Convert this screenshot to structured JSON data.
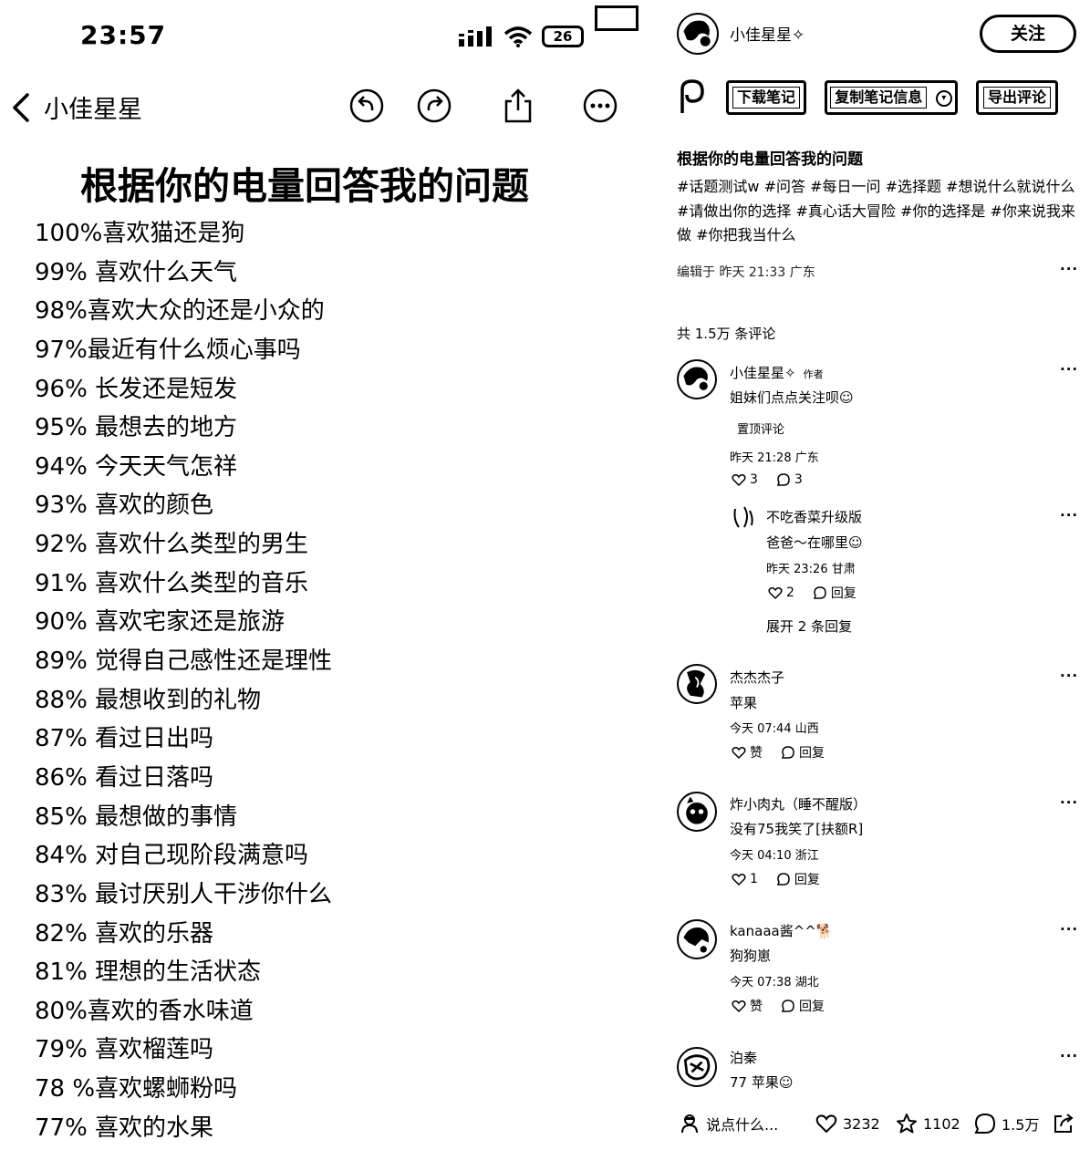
{
  "left": {
    "status": {
      "time": "23:57",
      "battery": "26"
    },
    "nav": {
      "title": "小佳星星"
    },
    "doc_title": "根据你的电量回答我的问题",
    "items": [
      "100%喜欢猫还是狗",
      "99% 喜欢什么天气",
      "98%喜欢大众的还是小众的",
      "97%最近有什么烦心事吗",
      "96% 长发还是短发",
      "95% 最想去的地方",
      "94% 今天天气怎祥",
      "93% 喜欢的颜色",
      "92% 喜欢什么类型的男生",
      "91% 喜欢什么类型的音乐",
      "90% 喜欢宅家还是旅游",
      "89% 觉得自己感性还是理性",
      "88% 最想收到的礼物",
      "87% 看过日出吗",
      "86% 看过日落吗",
      "85% 最想做的事情",
      "84% 对自己现阶段满意吗",
      "83% 最讨厌别人干涉你什么",
      "82% 喜欢的乐器",
      "81% 理想的生活状态",
      "80%喜欢的香水味道",
      "79% 喜欢榴莲吗",
      "78 %喜欢螺蛳粉吗",
      "77% 喜欢的水果"
    ]
  },
  "right": {
    "author": {
      "name": "小佳星星✧",
      "follow_label": "关注"
    },
    "toolbar": {
      "download": "下载笔记",
      "copy_info": "复制笔记信息",
      "export": "导出评论"
    },
    "note": {
      "title": "根据你的电量回答我的问题",
      "tags": "#话题测试w #问答 #每日一问 #选择题 #想说什么就说什么 #请做出你的选择 #真心话大冒险 #你的选择是 #你来说我来做 #你把我当什么",
      "meta": "编辑于 昨天 21:33 广东"
    },
    "comments_total": "共 1.5万 条评论",
    "more": "···",
    "comments": [
      {
        "name": "小佳星星✧",
        "badge": "作者",
        "text": "姐妹们点点关注呗☺",
        "pinned": "置顶评论",
        "time": "昨天 21:28 广东",
        "likes": "3",
        "replies": "3"
      },
      {
        "name": "不吃香菜升级版",
        "text": "爸爸～在哪里☺",
        "time": "昨天 23:26 甘肃",
        "likes": "2",
        "replies": "回复",
        "expand": "展开 2 条回复"
      },
      {
        "name": "杰杰杰子",
        "text": "苹果",
        "time": "今天 07:44 山西",
        "likes": "赞",
        "replies": "回复"
      },
      {
        "name": "炸小肉丸（睡不醒版）",
        "text": "没有75我笑了[扶额R]",
        "time": "今天 04:10 浙江",
        "likes": "1",
        "replies": "回复"
      },
      {
        "name": "kanaaa酱^^🐕",
        "text": "狗狗崽",
        "time": "今天 07:38 湖北",
        "likes": "赞",
        "replies": "回复"
      },
      {
        "name": "泊秦",
        "text": "77 苹果☺"
      }
    ],
    "bottom": {
      "placeholder": "说点什么...",
      "likes": "3232",
      "stars": "1102",
      "comments": "1.5万"
    }
  }
}
